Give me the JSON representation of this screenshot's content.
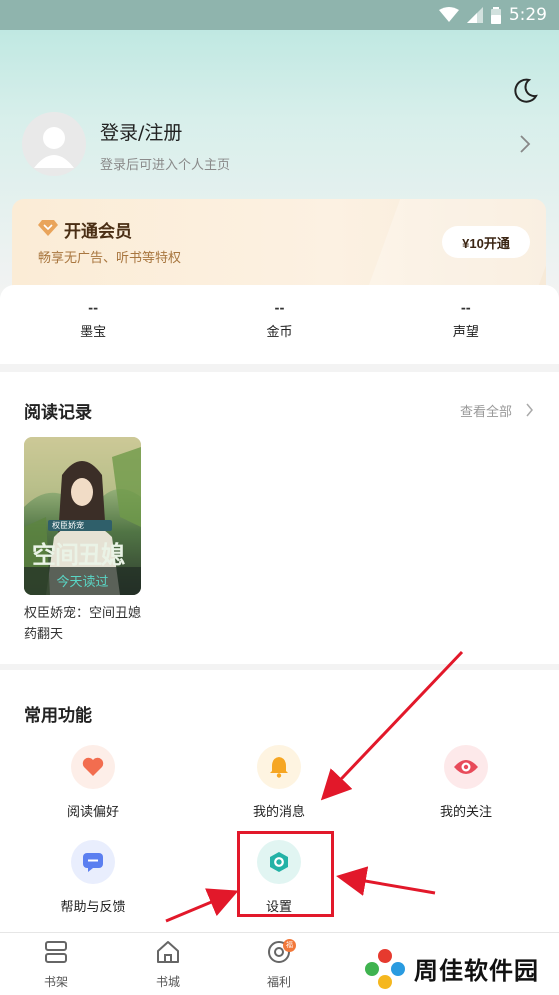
{
  "status_bar": {
    "time": "5:29"
  },
  "profile": {
    "title": "登录/注册",
    "subtitle": "登录后可进入个人主页"
  },
  "vip": {
    "title": "开通会员",
    "subtitle": "畅享无广告、听书等特权",
    "button": "¥10开通"
  },
  "stats": [
    {
      "value": "--",
      "label": "墨宝"
    },
    {
      "value": "--",
      "label": "金币"
    },
    {
      "value": "--",
      "label": "声望"
    }
  ],
  "reading": {
    "title": "阅读记录",
    "see_all": "查看全部",
    "book": {
      "title": "权臣娇宠：空间丑媳药翻天",
      "cover_series": "权臣娇宠",
      "cover_title": "空间丑媳",
      "cover_tag": "今天读过"
    }
  },
  "functions": {
    "title": "常用功能",
    "items": [
      {
        "label": "阅读偏好",
        "icon": "heart-icon",
        "color": "#f26d4f"
      },
      {
        "label": "我的消息",
        "icon": "bell-icon",
        "color": "#f6a623"
      },
      {
        "label": "我的关注",
        "icon": "eye-icon",
        "color": "#e84b5a"
      },
      {
        "label": "帮助与反馈",
        "icon": "message-icon",
        "color": "#5b7ff0"
      },
      {
        "label": "设置",
        "icon": "settings-icon",
        "color": "#23b2a6"
      }
    ]
  },
  "tabbar": {
    "items": [
      {
        "label": "书架",
        "icon": "bookshelf-icon"
      },
      {
        "label": "书城",
        "icon": "home-icon"
      },
      {
        "label": "福利",
        "icon": "coin-icon",
        "badge": "福"
      }
    ]
  },
  "watermark": {
    "text": "周佳软件园"
  },
  "colors": {
    "accent": "#23b2a6",
    "highlight": "#e2182a"
  }
}
